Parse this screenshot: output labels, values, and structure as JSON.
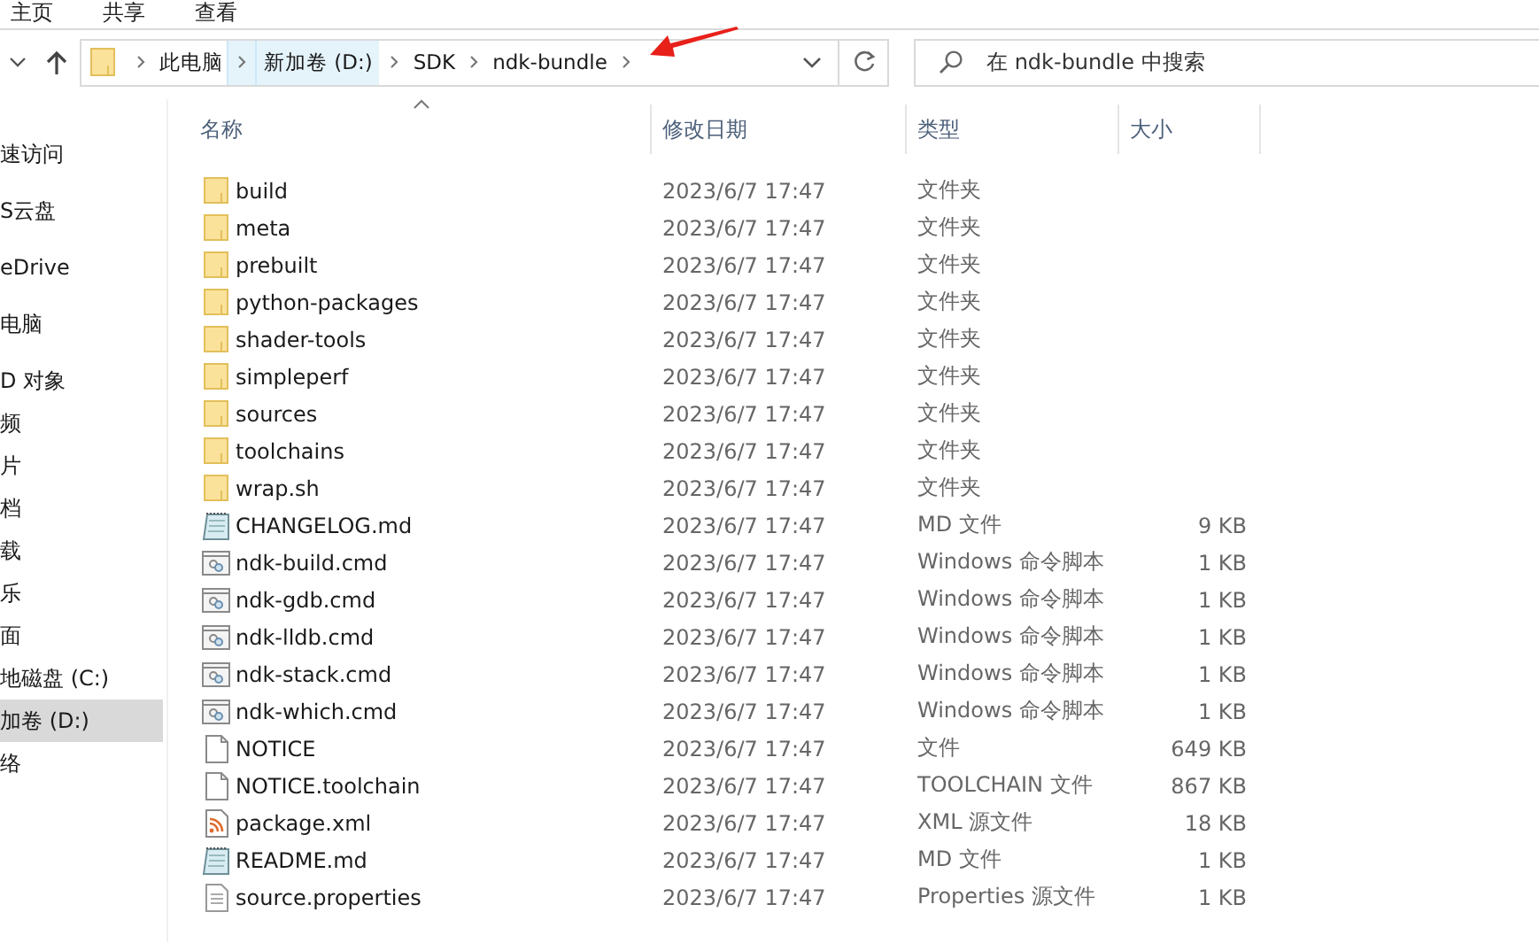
{
  "ribbon_tabs": [
    {
      "label": "主页"
    },
    {
      "label": "共享"
    },
    {
      "label": "查看"
    }
  ],
  "address_bar": {
    "segments": [
      {
        "label": "此电脑",
        "selected": false
      },
      {
        "label": "新加卷 (D:)",
        "selected": true
      },
      {
        "label": "SDK",
        "selected": false
      },
      {
        "label": "ndk-bundle",
        "selected": false
      }
    ]
  },
  "search": {
    "placeholder": "在 ndk-bundle 中搜索"
  },
  "sidebar": {
    "items": [
      {
        "label": "速访问",
        "selected": false
      },
      {
        "label": "S云盘",
        "selected": false
      },
      {
        "label": "eDrive",
        "selected": false
      },
      {
        "label": "电脑",
        "selected": false
      },
      {
        "label": "D 对象",
        "selected": false
      },
      {
        "label": "频",
        "selected": false
      },
      {
        "label": "片",
        "selected": false
      },
      {
        "label": "档",
        "selected": false
      },
      {
        "label": "载",
        "selected": false
      },
      {
        "label": "乐",
        "selected": false
      },
      {
        "label": "面",
        "selected": false
      },
      {
        "label": "地磁盘 (C:)",
        "selected": false
      },
      {
        "label": "加卷 (D:)",
        "selected": true
      },
      {
        "label": "络",
        "selected": false
      }
    ]
  },
  "table": {
    "columns": [
      "名称",
      "修改日期",
      "类型",
      "大小"
    ],
    "rows": [
      {
        "kind": "folder",
        "name": "build",
        "modified": "2023/6/7 17:47",
        "type": "文件夹"
      },
      {
        "kind": "folder",
        "name": "meta",
        "modified": "2023/6/7 17:47",
        "type": "文件夹"
      },
      {
        "kind": "folder",
        "name": "prebuilt",
        "modified": "2023/6/7 17:47",
        "type": "文件夹"
      },
      {
        "kind": "folder",
        "name": "python-packages",
        "modified": "2023/6/7 17:47",
        "type": "文件夹"
      },
      {
        "kind": "folder",
        "name": "shader-tools",
        "modified": "2023/6/7 17:47",
        "type": "文件夹"
      },
      {
        "kind": "folder",
        "name": "simpleperf",
        "modified": "2023/6/7 17:47",
        "type": "文件夹"
      },
      {
        "kind": "folder",
        "name": "sources",
        "modified": "2023/6/7 17:47",
        "type": "文件夹"
      },
      {
        "kind": "folder",
        "name": "toolchains",
        "modified": "2023/6/7 17:47",
        "type": "文件夹"
      },
      {
        "kind": "folder",
        "name": "wrap.sh",
        "modified": "2023/6/7 17:47",
        "type": "文件夹"
      },
      {
        "kind": "notepad",
        "name": "CHANGELOG.md",
        "modified": "2023/6/7 17:47",
        "type": "MD 文件",
        "size": "9 KB"
      },
      {
        "kind": "script",
        "name": "ndk-build.cmd",
        "modified": "2023/6/7 17:47",
        "type": "Windows 命令脚本",
        "size": "1 KB"
      },
      {
        "kind": "script",
        "name": "ndk-gdb.cmd",
        "modified": "2023/6/7 17:47",
        "type": "Windows 命令脚本",
        "size": "1 KB"
      },
      {
        "kind": "script",
        "name": "ndk-lldb.cmd",
        "modified": "2023/6/7 17:47",
        "type": "Windows 命令脚本",
        "size": "1 KB"
      },
      {
        "kind": "script",
        "name": "ndk-stack.cmd",
        "modified": "2023/6/7 17:47",
        "type": "Windows 命令脚本",
        "size": "1 KB"
      },
      {
        "kind": "script",
        "name": "ndk-which.cmd",
        "modified": "2023/6/7 17:47",
        "type": "Windows 命令脚本",
        "size": "1 KB"
      },
      {
        "kind": "file",
        "name": "NOTICE",
        "modified": "2023/6/7 17:47",
        "type": "文件",
        "size": "649 KB"
      },
      {
        "kind": "file",
        "name": "NOTICE.toolchain",
        "modified": "2023/6/7 17:47",
        "type": "TOOLCHAIN 文件",
        "size": "867 KB"
      },
      {
        "kind": "xml",
        "name": "package.xml",
        "modified": "2023/6/7 17:47",
        "type": "XML 源文件",
        "size": "18 KB"
      },
      {
        "kind": "notepad",
        "name": "README.md",
        "modified": "2023/6/7 17:47",
        "type": "MD 文件",
        "size": "1 KB"
      },
      {
        "kind": "lines",
        "name": "source.properties",
        "modified": "2023/6/7 17:47",
        "type": "Properties 源文件",
        "size": "1 KB"
      }
    ]
  }
}
